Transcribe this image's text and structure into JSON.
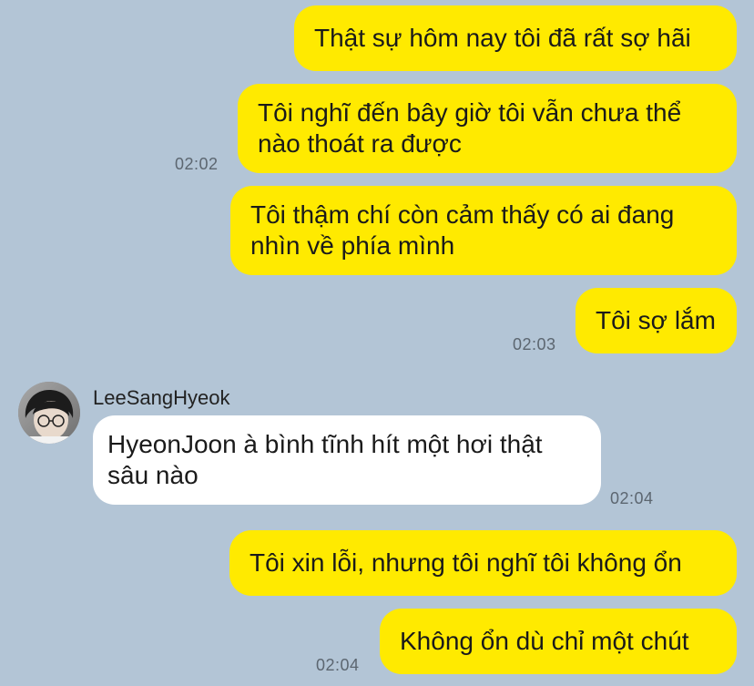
{
  "messages": [
    {
      "text": "Thật sự hôm nay tôi đã rất sợ hãi"
    },
    {
      "text": "Tôi nghĩ đến bây giờ tôi vẫn chưa thể\nnào thoát ra được",
      "time": "02:02"
    },
    {
      "text": "Tôi thậm chí còn cảm thấy có ai đang\nnhìn về phía mình"
    },
    {
      "text": "Tôi sợ lắm",
      "time": "02:03"
    },
    {
      "sender": "LeeSangHyeok",
      "text": "HyeonJoon à bình tĩnh hít một hơi thật\nsâu nào",
      "time": "02:04"
    },
    {
      "text": "Tôi xin lỗi, nhưng tôi nghĩ tôi không ổn"
    },
    {
      "text": "Không ổn dù chỉ một chút",
      "time": "02:04"
    }
  ],
  "colors": {
    "background": "#b3c5d6",
    "outgoing_bubble": "#ffea00",
    "incoming_bubble": "#ffffff"
  },
  "icons": {
    "avatar": "profile-photo"
  }
}
